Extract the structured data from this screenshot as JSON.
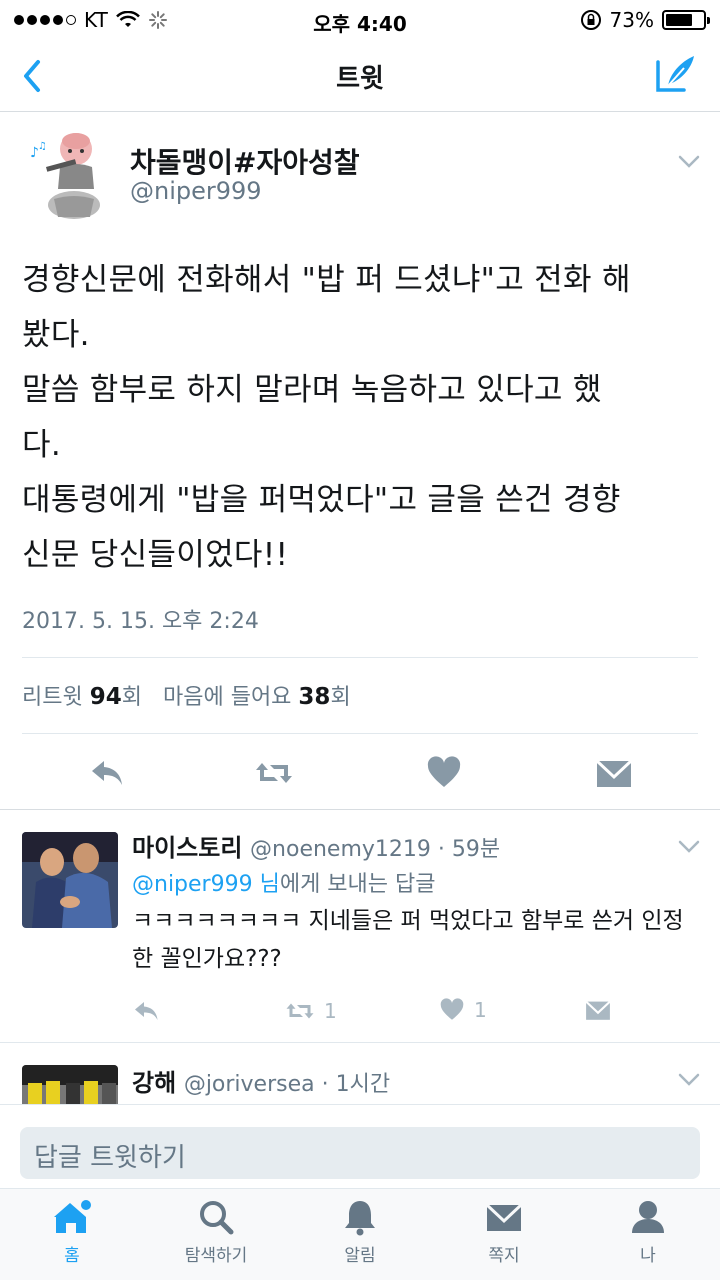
{
  "status_bar": {
    "carrier": "KT",
    "time": "오후 4:40",
    "battery": "73%",
    "battery_level": 0.73
  },
  "nav": {
    "title": "트윗"
  },
  "tweet": {
    "display_name": "차돌맹이#자아성찰",
    "handle": "@niper999",
    "text": "경향신문에 전화해서 \"밥 퍼 드셨냐\"고 전화 해\n봤다.\n말씀 함부로 하지 말라며 녹음하고 있다고 했\n다.\n대통령에게 \"밥을 퍼먹었다\"고 글을 쓴건 경향\n신문 당신들이었다!!",
    "timestamp": "2017. 5. 15. 오후 2:24",
    "retweet_label": "리트윗",
    "retweet_count": "94",
    "retweet_unit": "회",
    "like_label": "마음에 들어요",
    "like_count": "38",
    "like_unit": "회"
  },
  "replies": [
    {
      "name": "마이스토리",
      "meta": "@noenemy1219 · 59분",
      "reply_to_mention": "@niper999 님",
      "reply_to_suffix": "에게 보내는 답글",
      "text": "ㅋㅋㅋㅋㅋㅋㅋㅋ 지네들은 퍼 먹었다고 함부로 쓴거 인정한 꼴인가요???",
      "retweets": "1",
      "likes": "1"
    },
    {
      "name": "강해",
      "meta": "@joriversea · 1시간"
    }
  ],
  "composer": {
    "placeholder": "답글 트윗하기"
  },
  "tabs": [
    {
      "label": "홈",
      "icon": "home-icon"
    },
    {
      "label": "탐색하기",
      "icon": "search-icon"
    },
    {
      "label": "알림",
      "icon": "bell-icon"
    },
    {
      "label": "쪽지",
      "icon": "mail-icon"
    },
    {
      "label": "나",
      "icon": "person-icon"
    }
  ],
  "colors": {
    "accent": "#1da1f2",
    "secondary_text": "#657786",
    "icon_gray": "#8899a6"
  }
}
